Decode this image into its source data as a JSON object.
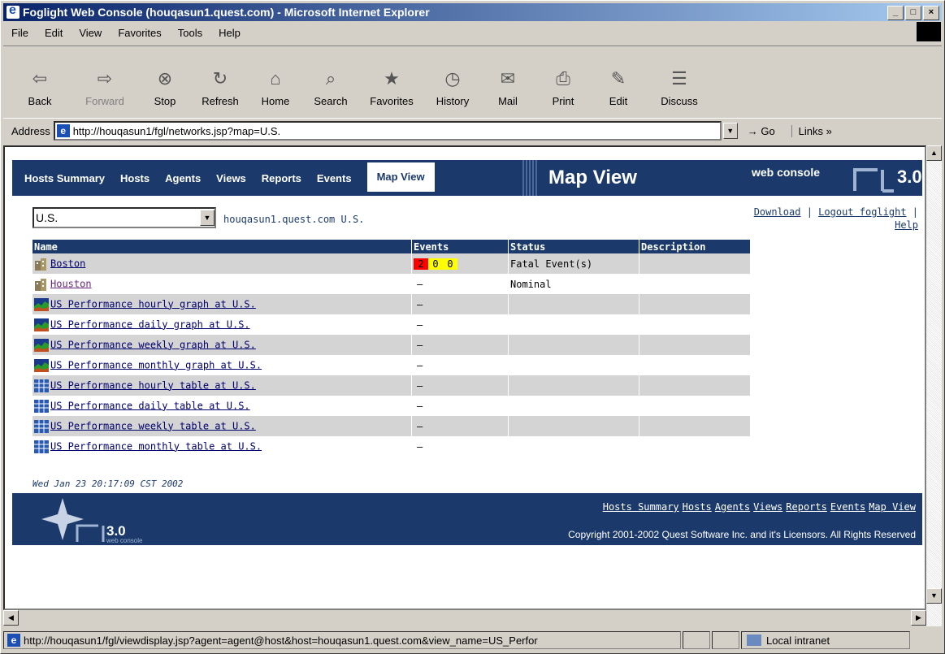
{
  "window": {
    "title": "Foglight Web Console (houqasun1.quest.com) - Microsoft Internet Explorer"
  },
  "menu": [
    "File",
    "Edit",
    "View",
    "Favorites",
    "Tools",
    "Help"
  ],
  "toolbar": [
    {
      "label": "Back",
      "icon": "back-arrow-icon",
      "disabled": false
    },
    {
      "label": "Forward",
      "icon": "forward-arrow-icon",
      "disabled": true
    },
    {
      "label": "Stop",
      "icon": "stop-icon",
      "disabled": false
    },
    {
      "label": "Refresh",
      "icon": "refresh-icon",
      "disabled": false
    },
    {
      "label": "Home",
      "icon": "home-icon",
      "disabled": false
    },
    {
      "label": "Search",
      "icon": "search-icon",
      "disabled": false
    },
    {
      "label": "Favorites",
      "icon": "favorites-icon",
      "disabled": false
    },
    {
      "label": "History",
      "icon": "history-icon",
      "disabled": false
    },
    {
      "label": "Mail",
      "icon": "mail-icon",
      "disabled": false
    },
    {
      "label": "Print",
      "icon": "print-icon",
      "disabled": false
    },
    {
      "label": "Edit",
      "icon": "edit-icon",
      "disabled": false
    },
    {
      "label": "Discuss",
      "icon": "discuss-icon",
      "disabled": false
    }
  ],
  "address": {
    "label": "Address",
    "url": "http://houqasun1/fgl/networks.jsp?map=U.S.",
    "go": "Go",
    "links": "Links"
  },
  "nav": {
    "tabs": [
      "Hosts Summary",
      "Hosts",
      "Agents",
      "Views",
      "Reports",
      "Events",
      "Map View"
    ],
    "active": "Map View",
    "heading": "Map View",
    "product": "web console",
    "logo": "3.0"
  },
  "map": {
    "selected": "U.S.",
    "host_label": "houqasun1.quest.com U.S."
  },
  "top_links": {
    "download": "Download",
    "logout": "Logout foglight",
    "help": "Help"
  },
  "table": {
    "headers": [
      "Name",
      "Events",
      "Status",
      "Description"
    ],
    "rows": [
      {
        "name": "Boston",
        "icon": "building-icon",
        "events": [
          "2",
          "0",
          "0"
        ],
        "status": "Fatal Event(s)",
        "visited": false
      },
      {
        "name": "Houston",
        "icon": "building-icon",
        "events_text": "–",
        "status": "Nominal",
        "visited": true
      },
      {
        "name": "US Performance hourly graph at U.S.",
        "icon": "graph-icon",
        "events_text": "–",
        "status": ""
      },
      {
        "name": "US Performance daily graph at U.S.",
        "icon": "graph-icon",
        "events_text": "–",
        "status": ""
      },
      {
        "name": "US Performance weekly graph at U.S.",
        "icon": "graph-icon",
        "events_text": "–",
        "status": ""
      },
      {
        "name": "US Performance monthly graph at U.S.",
        "icon": "graph-icon",
        "events_text": "–",
        "status": ""
      },
      {
        "name": "US Performance hourly table at U.S.",
        "icon": "table-icon",
        "events_text": "–",
        "status": ""
      },
      {
        "name": "US Performance daily table at U.S.",
        "icon": "table-icon",
        "events_text": "–",
        "status": ""
      },
      {
        "name": "US Performance weekly table at U.S.",
        "icon": "table-icon",
        "events_text": "–",
        "status": ""
      },
      {
        "name": "US Performance monthly table at U.S.",
        "icon": "table-icon",
        "events_text": "–",
        "status": ""
      }
    ]
  },
  "timestamp": "Wed Jan 23 20:17:09 CST 2002",
  "footer": {
    "links": [
      "Hosts Summary",
      "Hosts",
      "Agents",
      "Views",
      "Reports",
      "Events",
      "Map View"
    ],
    "copyright": "Copyright 2001-2002 Quest Software Inc. and it's Licensors. All Rights Reserved",
    "logo_version": "3.0",
    "logo_sub": "web console"
  },
  "statusbar": {
    "url": "http://houqasun1/fgl/viewdisplay.jsp?agent=agent@host&host=houqasun1.quest.com&view_name=US_Perfor",
    "zone": "Local intranet"
  },
  "colors": {
    "nav": "#1b3a6b",
    "event_fatal": "#ff0000",
    "event_warn": "#ffff00"
  }
}
